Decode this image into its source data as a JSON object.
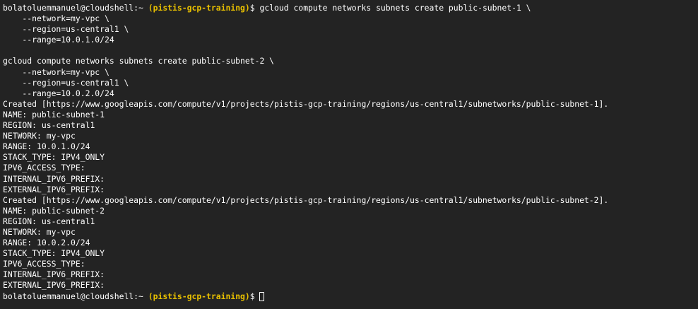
{
  "terminal": {
    "prompt": {
      "user_host": "bolatoluemmanuel@cloudshell:",
      "cwd": "~",
      "project": "(pistis-gcp-training)",
      "sigil": "$"
    },
    "first_command": "gcloud compute networks subnets create public-subnet-1 \\",
    "lines": [
      "    --network=my-vpc \\",
      "    --region=us-central1 \\",
      "    --range=10.0.1.0/24",
      "",
      "gcloud compute networks subnets create public-subnet-2 \\",
      "    --network=my-vpc \\",
      "    --region=us-central1 \\",
      "    --range=10.0.2.0/24",
      "Created [https://www.googleapis.com/compute/v1/projects/pistis-gcp-training/regions/us-central1/subnetworks/public-subnet-1].",
      "NAME: public-subnet-1",
      "REGION: us-central1",
      "NETWORK: my-vpc",
      "RANGE: 10.0.1.0/24",
      "STACK_TYPE: IPV4_ONLY",
      "IPV6_ACCESS_TYPE:",
      "INTERNAL_IPV6_PREFIX:",
      "EXTERNAL_IPV6_PREFIX:",
      "Created [https://www.googleapis.com/compute/v1/projects/pistis-gcp-training/regions/us-central1/subnetworks/public-subnet-2].",
      "NAME: public-subnet-2",
      "REGION: us-central1",
      "NETWORK: my-vpc",
      "RANGE: 10.0.2.0/24",
      "STACK_TYPE: IPV4_ONLY",
      "IPV6_ACCESS_TYPE:",
      "INTERNAL_IPV6_PREFIX:",
      "EXTERNAL_IPV6_PREFIX:"
    ]
  },
  "colors": {
    "background": "#232323",
    "text": "#ffffff",
    "project": "#e8c000"
  }
}
